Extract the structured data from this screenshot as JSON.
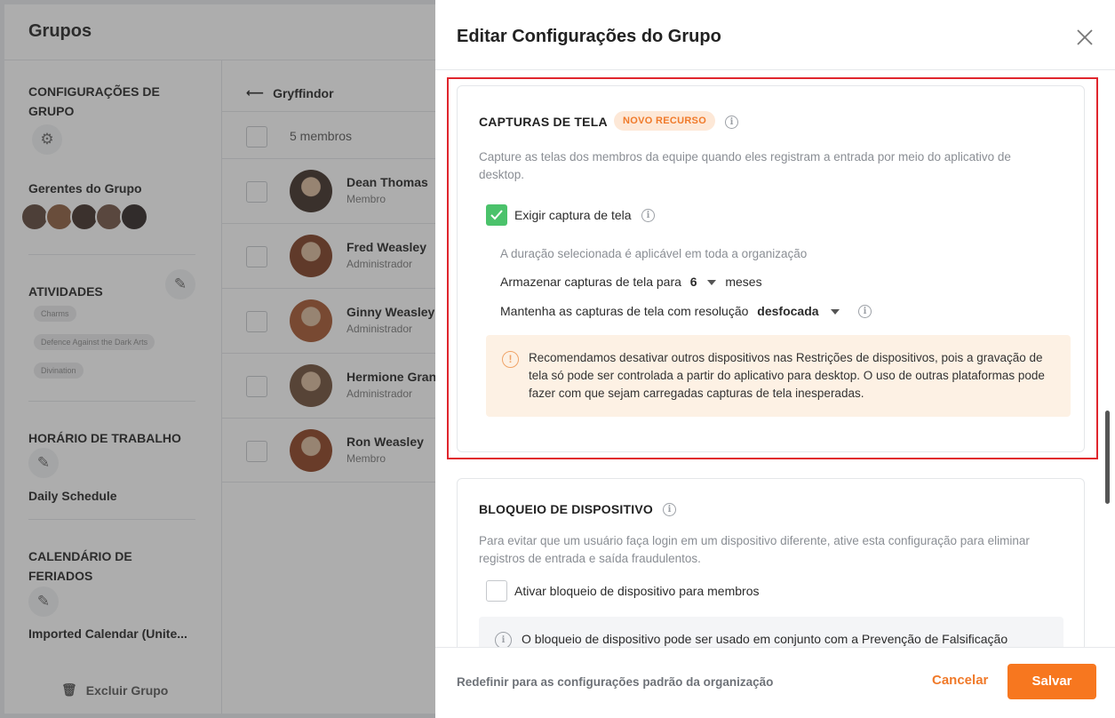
{
  "app": {
    "title": "Grupos",
    "left_panel": {
      "group_settings_heading": "CONFIGURAÇÕES DE GRUPO",
      "managers_label": "Gerentes do Grupo",
      "activities_heading": "ATIVIDADES",
      "activity_chips": [
        "Charms",
        "Defence Against the Dark Arts",
        "Divination"
      ],
      "work_hours_heading": "HORÁRIO DE TRABALHO",
      "work_hours_value": "Daily Schedule",
      "holiday_heading": "CALENDÁRIO DE FERIADOS",
      "holiday_value": "Imported Calendar (Unite...",
      "delete_label": "Excluir Grupo"
    },
    "middle_panel": {
      "group_name": "Gryffindor",
      "member_count": "5 membros",
      "members": [
        {
          "name": "Dean Thomas",
          "role": "Membro",
          "color": "#3a2a22"
        },
        {
          "name": "Fred Weasley",
          "role": "Administrador",
          "color": "#7a3a1e"
        },
        {
          "name": "Ginny Weasley",
          "role": "Administrador",
          "color": "#a4532b"
        },
        {
          "name": "Hermione Gran",
          "role": "Administrador",
          "color": "#6b4a34"
        },
        {
          "name": "Ron Weasley",
          "role": "Membro",
          "color": "#8a3d1c"
        }
      ]
    }
  },
  "drawer": {
    "title": "Editar Configurações do Grupo",
    "screenshots": {
      "title": "CAPTURAS DE TELA",
      "badge": "NOVO RECURSO",
      "description": "Capture as telas dos membros da equipe quando eles registram a entrada por meio do aplicativo de desktop.",
      "require_label": "Exigir captura de tela",
      "require_checked": true,
      "org_note": "A duração selecionada é aplicável em toda a organização",
      "store_prefix": "Armazenar capturas de tela para",
      "store_value": "6",
      "store_suffix": "meses",
      "resolution_prefix": "Mantenha as capturas de tela com resolução",
      "resolution_value": "desfocada",
      "warning": "Recomendamos desativar outros dispositivos nas Restrições de dispositivos, pois a gravação de tela só pode ser controlada a partir do aplicativo para desktop. O uso de outras plataformas pode fazer com que sejam carregadas capturas de tela inesperadas."
    },
    "device_lock": {
      "title": "BLOQUEIO DE DISPOSITIVO",
      "description": "Para evitar que um usuário faça login em um dispositivo diferente, ative esta configuração para eliminar registros de entrada e saída fraudulentos.",
      "enable_label": "Ativar bloqueio de dispositivo para membros",
      "enable_checked": false,
      "note": "O bloqueio de dispositivo pode ser usado em conjunto com a Prevenção de Falsificação"
    },
    "footer": {
      "reset_label": "Redefinir para as configurações padrão da organização",
      "cancel_label": "Cancelar",
      "save_label": "Salvar"
    }
  },
  "colors": {
    "accent": "#f7771f",
    "check_green": "#4bc26b",
    "highlight_red": "#e0262d",
    "warning_bg": "#fdf1e4"
  }
}
